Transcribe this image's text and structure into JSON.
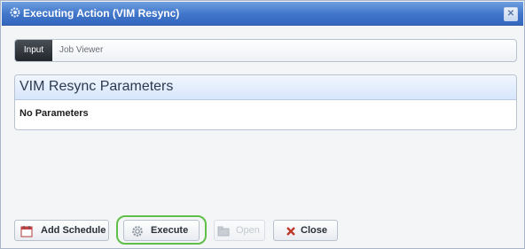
{
  "window": {
    "title": "Executing Action (VIM Resync)",
    "close_symbol": "✕"
  },
  "tabs": [
    {
      "label": "Input",
      "active": true
    },
    {
      "label": "Job Viewer",
      "active": false
    }
  ],
  "panel": {
    "title": "VIM Resync Parameters",
    "body": "No Parameters"
  },
  "buttons": {
    "add_schedule": "Add Schedule",
    "execute": "Execute",
    "open": "Open",
    "close": "Close"
  },
  "icons": {
    "title": "gear-icon",
    "add_schedule": "calendar-icon",
    "execute": "gear-icon",
    "open": "folder-icon",
    "close": "close-x-icon"
  },
  "colors": {
    "title_bar": "#3f74c9",
    "execute_highlight": "#5fbf49",
    "close_icon": "#c0392b"
  }
}
